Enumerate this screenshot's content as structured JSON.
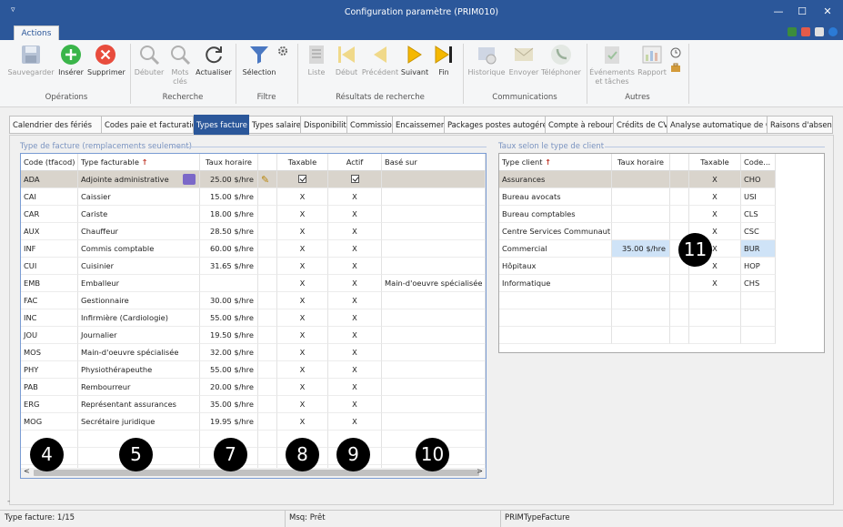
{
  "window": {
    "title": "Configuration paramètre (PRIM010)"
  },
  "ribbon_tab": "Actions",
  "ribbon": {
    "buttons": [
      {
        "label": "Sauvegarder",
        "icon": "floppy-icon",
        "enabled": false
      },
      {
        "label": "Insérer",
        "icon": "plus-circle-icon",
        "enabled": true
      },
      {
        "label": "Supprimer",
        "icon": "x-circle-icon",
        "enabled": true
      },
      {
        "label": "Débuter",
        "icon": "magnifier-icon",
        "enabled": false
      },
      {
        "label": "Mots clés",
        "icon": "magnifier-keywords-icon",
        "enabled": false
      },
      {
        "label": "Actualiser",
        "icon": "refresh-icon",
        "enabled": true
      },
      {
        "label": "Sélection",
        "icon": "funnel-icon",
        "enabled": true
      },
      {
        "label": "Liste",
        "icon": "list-icon",
        "enabled": false
      },
      {
        "label": "Début",
        "icon": "first-icon",
        "enabled": false
      },
      {
        "label": "Précédent",
        "icon": "previous-icon",
        "enabled": false
      },
      {
        "label": "Suivant",
        "icon": "next-icon",
        "enabled": true
      },
      {
        "label": "Fin",
        "icon": "last-icon",
        "enabled": true
      },
      {
        "label": "Historique",
        "icon": "history-icon",
        "enabled": false
      },
      {
        "label": "Envoyer",
        "icon": "envelope-icon",
        "enabled": false
      },
      {
        "label": "Téléphoner",
        "icon": "phone-icon",
        "enabled": false
      },
      {
        "label": "Événements et tâches",
        "icon": "clipboard-icon",
        "enabled": false
      },
      {
        "label": "Rapport",
        "icon": "report-icon",
        "enabled": false
      }
    ],
    "groups": [
      "Opérations",
      "Recherche",
      "Filtre",
      "Résultats de recherche",
      "Communications",
      "Autres"
    ]
  },
  "tabs": [
    {
      "label": "Calendrier des fériés"
    },
    {
      "label": "Codes paie et facturation"
    },
    {
      "label": "Types facture",
      "active": true
    },
    {
      "label": "Types salaire"
    },
    {
      "label": "Disponibilité"
    },
    {
      "label": "Commission"
    },
    {
      "label": "Encaissement"
    },
    {
      "label": "Packages postes autogérés"
    },
    {
      "label": "Compte à rebours"
    },
    {
      "label": "Crédits de CV"
    },
    {
      "label": "Analyse automatique de CV"
    },
    {
      "label": "Raisons d'absence"
    }
  ],
  "left_grid": {
    "section_title": "Type de facture (remplacements seulement)",
    "headers": [
      "Code (tfacod)",
      "Type facturable",
      "Taux horaire",
      "Taxable",
      "Actif",
      "Basé sur"
    ],
    "rows": [
      {
        "code": "ADA",
        "type": "Adjointe administrative",
        "taux": "25.00 $/hre",
        "taxable": "☑",
        "actif": "☑",
        "base": ""
      },
      {
        "code": "CAI",
        "type": "Caissier",
        "taux": "15.00 $/hre",
        "taxable": "X",
        "actif": "X",
        "base": ""
      },
      {
        "code": "CAR",
        "type": "Cariste",
        "taux": "18.00 $/hre",
        "taxable": "X",
        "actif": "X",
        "base": ""
      },
      {
        "code": "AUX",
        "type": "Chauffeur",
        "taux": "28.50 $/hre",
        "taxable": "X",
        "actif": "X",
        "base": ""
      },
      {
        "code": "INF",
        "type": "Commis comptable",
        "taux": "60.00 $/hre",
        "taxable": "X",
        "actif": "X",
        "base": ""
      },
      {
        "code": "CUI",
        "type": "Cuisinier",
        "taux": "31.65 $/hre",
        "taxable": "X",
        "actif": "X",
        "base": ""
      },
      {
        "code": "EMB",
        "type": "Emballeur",
        "taux": "",
        "taxable": "X",
        "actif": "X",
        "base": "Main-d'oeuvre spécialisée"
      },
      {
        "code": "FAC",
        "type": "Gestionnaire",
        "taux": "30.00 $/hre",
        "taxable": "X",
        "actif": "X",
        "base": ""
      },
      {
        "code": "INC",
        "type": "Infirmière (Cardiologie)",
        "taux": "55.00 $/hre",
        "taxable": "X",
        "actif": "X",
        "base": ""
      },
      {
        "code": "JOU",
        "type": "Journalier",
        "taux": "19.50 $/hre",
        "taxable": "X",
        "actif": "X",
        "base": ""
      },
      {
        "code": "MOS",
        "type": "Main-d'oeuvre spécialisée",
        "taux": "32.00 $/hre",
        "taxable": "X",
        "actif": "X",
        "base": ""
      },
      {
        "code": "PHY",
        "type": "Physiothérapeuthe",
        "taux": "55.00 $/hre",
        "taxable": "X",
        "actif": "X",
        "base": ""
      },
      {
        "code": "PAB",
        "type": "Rembourreur",
        "taux": "20.00 $/hre",
        "taxable": "X",
        "actif": "X",
        "base": ""
      },
      {
        "code": "ERG",
        "type": "Représentant assurances",
        "taux": "35.00 $/hre",
        "taxable": "X",
        "actif": "X",
        "base": ""
      },
      {
        "code": "MOG",
        "type": "Secrétaire juridique",
        "taux": "19.95 $/hre",
        "taxable": "X",
        "actif": "X",
        "base": ""
      }
    ]
  },
  "right_grid": {
    "section_title": "Taux selon le type de client",
    "headers": [
      "Type client",
      "Taux horaire",
      "Taxable",
      "Code..."
    ],
    "rows": [
      {
        "type": "Assurances",
        "taux": "",
        "taxable": "X",
        "code": "CHO"
      },
      {
        "type": "Bureau avocats",
        "taux": "",
        "taxable": "X",
        "code": "USI"
      },
      {
        "type": "Bureau comptables",
        "taux": "",
        "taxable": "X",
        "code": "CLS"
      },
      {
        "type": "Centre Services Communaut...",
        "taux": "",
        "taxable": "X",
        "code": "CSC"
      },
      {
        "type": "Commercial",
        "taux": "35.00 $/hre",
        "taxable": "X",
        "code": "BUR"
      },
      {
        "type": "Hôpitaux",
        "taux": "",
        "taxable": "X",
        "code": "HOP"
      },
      {
        "type": "Informatique",
        "taux": "",
        "taxable": "X",
        "code": "CHS"
      }
    ]
  },
  "callouts": [
    "4",
    "5",
    "7",
    "8",
    "9",
    "10",
    "11"
  ],
  "status": {
    "left": "Type facture: 1/15",
    "middle": "Msq: Prêt",
    "right": "PRIMTypeFacture"
  },
  "colors": {
    "accent": "#2b579a",
    "selected_row": "#d9d4cc",
    "highlight": "#cfe3f7"
  }
}
